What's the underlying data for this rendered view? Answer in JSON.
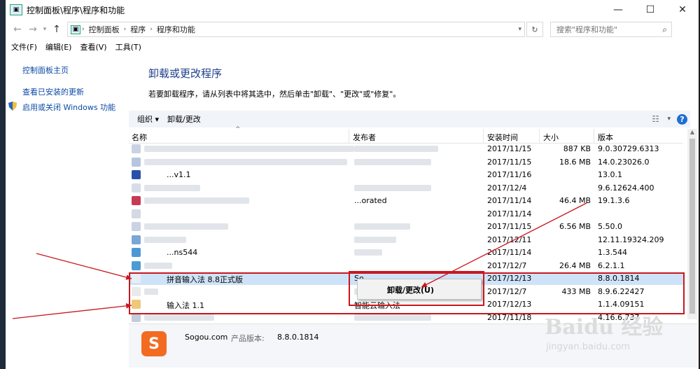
{
  "window": {
    "title": "控制面板\\程序\\程序和功能",
    "controls": {
      "minimize": "—",
      "maximize": "☐",
      "close": "✕"
    }
  },
  "address": {
    "crumbs": [
      "控制面板",
      "程序",
      "程序和功能"
    ],
    "search_placeholder": "搜索\"程序和功能\""
  },
  "menubar": [
    "文件(F)",
    "编辑(E)",
    "查看(V)",
    "工具(T)"
  ],
  "sidebar": {
    "home": "控制面板主页",
    "installed_updates": "查看已安装的更新",
    "windows_features": "启用或关闭 Windows 功能"
  },
  "main": {
    "heading": "卸载或更改程序",
    "description": "若要卸载程序，请从列表中将其选中，然后单击\"卸载\"、\"更改\"或\"修复\"。"
  },
  "toolbar": {
    "organize": "组织 ▾",
    "uninstall_change": "卸载/更改"
  },
  "columns": [
    "名称",
    "发布者",
    "安装时间",
    "大小",
    "版本"
  ],
  "rows": [
    {
      "name": "",
      "publisher": "",
      "date": "2017/11/15",
      "size": "887 KB",
      "version": "9.0.30729.6313"
    },
    {
      "name": "",
      "publisher": "",
      "date": "2017/11/15",
      "size": "18.6 MB",
      "version": "14.0.23026.0"
    },
    {
      "name": "...v1.1",
      "publisher": "",
      "date": "2017/11/16",
      "size": "",
      "version": "13.0.1"
    },
    {
      "name": "",
      "publisher": "",
      "date": "2017/12/4",
      "size": "",
      "version": "9.6.12624.400"
    },
    {
      "name": "",
      "publisher": "...orated",
      "date": "2017/11/14",
      "size": "46.4 MB",
      "version": "19.1.3.6"
    },
    {
      "name": "",
      "publisher": "",
      "date": "2017/11/14",
      "size": "",
      "version": ""
    },
    {
      "name": "",
      "publisher": "",
      "date": "2017/11/15",
      "size": "6.56 MB",
      "version": "5.50.0"
    },
    {
      "name": "",
      "publisher": "",
      "date": "2017/12/11",
      "size": "",
      "version": "12.11.19324.209"
    },
    {
      "name": "...ns544",
      "publisher": "",
      "date": "2017/11/14",
      "size": "",
      "version": "1.3.544"
    },
    {
      "name": "",
      "publisher": "",
      "date": "2017/12/7",
      "size": "26.4 MB",
      "version": "6.2.1.1"
    },
    {
      "name": "拼音输入法 8.8正式版",
      "publisher": "So",
      "date": "2017/12/13",
      "size": "",
      "version": "8.8.0.1814",
      "selected": true
    },
    {
      "name": "",
      "publisher": "",
      "date": "2017/12/7",
      "size": "433 MB",
      "version": "8.9.6.22427"
    },
    {
      "name": "输入法 1.1",
      "publisher": "智能云输入法",
      "date": "2017/12/13",
      "size": "",
      "version": "1.1.4.09151"
    },
    {
      "name": "",
      "publisher": "",
      "date": "2017/11/18",
      "size": "",
      "version": "4.16.6.737"
    }
  ],
  "details": {
    "name": "Sogou.com",
    "label": "产品版本:",
    "version": "8.8.0.1814"
  },
  "context_menu": {
    "item": "卸载/更改(U)"
  },
  "watermark": {
    "text": "Baidu 经验",
    "url": "jingyan.baidu.com"
  }
}
